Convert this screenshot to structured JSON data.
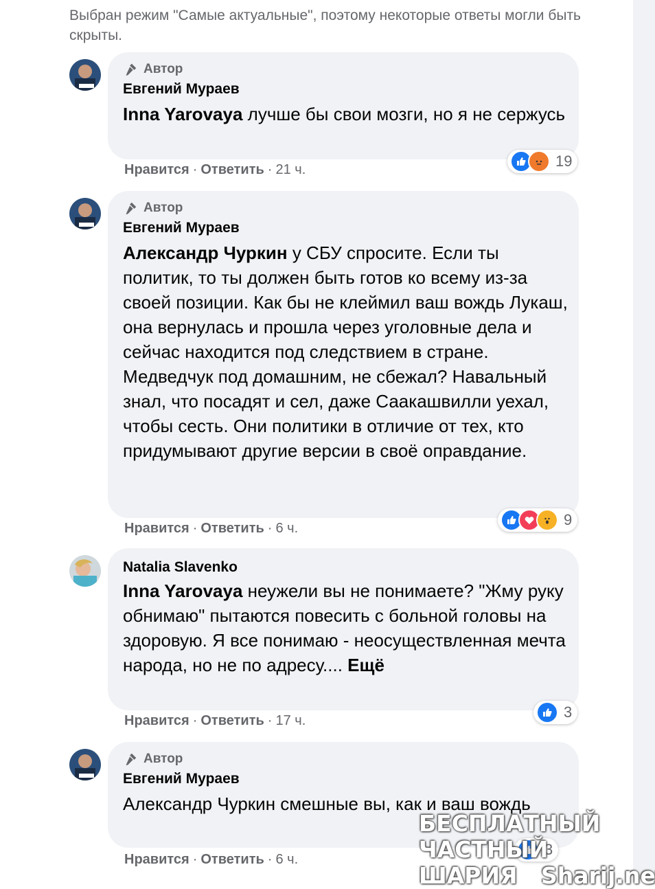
{
  "notice": "Выбран режим \"Самые актуальные\", поэтому некоторые ответы могли быть скрыты.",
  "comments": [
    {
      "author_badge": "Автор",
      "name": "Евгений Мураев",
      "mention": "Inna Yarovaya",
      "text": " лучше бы свои мозги, но я не сержусь",
      "like": "Нравится",
      "reply": "Ответить",
      "time": "21 ч.",
      "reaction_count": "19",
      "reaction_icons": [
        "like-icon",
        "angry-icon"
      ]
    },
    {
      "author_badge": "Автор",
      "name": "Евгений Мураев",
      "mention": "Александр Чуркин",
      "text": " у СБУ спросите. Если ты политик, то ты должен быть готов ко всему из-за своей позиции. Как бы не клеймил ваш вождь Лукаш, она вернулась и прошла через уголовные дела и сейчас находится под следствием в стране. Медведчук под домашним, не сбежал? Навальный знал, что посадят и сел, даже Саакашвилли уехал, чтобы сесть. Они политики в отличие от тех, кто придумывают другие версии в своё оправдание.",
      "like": "Нравится",
      "reply": "Ответить",
      "time": "6 ч.",
      "reaction_count": "9",
      "reaction_icons": [
        "like-icon",
        "love-icon",
        "wow-icon"
      ]
    },
    {
      "name": "Natalia Slavenko",
      "mention": "Inna Yarovaya",
      "text": " неужели вы не понимаете? \"Жму руку обнимаю\" пытаются повесить с больной головы на здоровую. Я все понимаю - неосуществленная мечта народа, но не по адресу.... ",
      "more": "Ещё",
      "like": "Нравится",
      "reply": "Ответить",
      "time": "17 ч.",
      "reaction_count": "3",
      "reaction_icons": [
        "like-icon"
      ]
    },
    {
      "author_badge": "Автор",
      "name": "Евгений Мураев",
      "text": "Александр Чуркин смешные вы, как и ваш вождь",
      "like": "Нравится",
      "reply": "Ответить",
      "time": "6 ч.",
      "reaction_count": "3",
      "reaction_icons": [
        "like-icon"
      ]
    }
  ],
  "watermark": {
    "line1": "БЕСПЛАТНЫЙ ЧАСТНЫЙ",
    "line2": "ШАРИЯ",
    "line3": "Sharij.net"
  },
  "colors": {
    "bubble": "#f0f2f5",
    "secondary_text": "#65676b",
    "like_blue": "#1877f2"
  }
}
